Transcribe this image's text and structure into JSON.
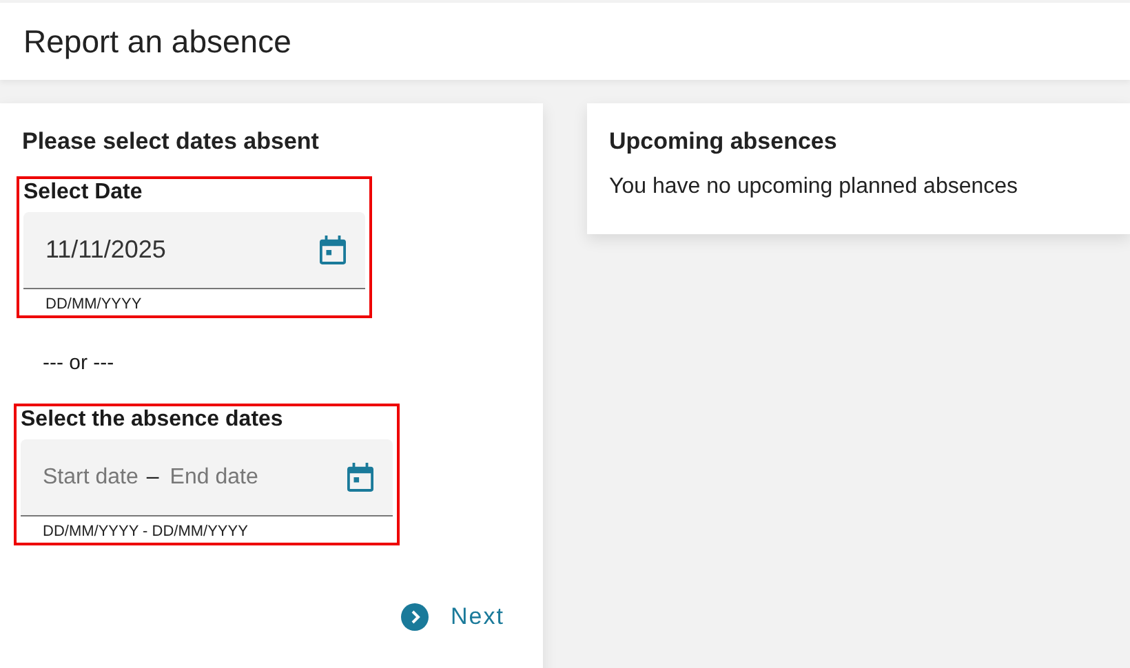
{
  "header": {
    "title": "Report an absence"
  },
  "form": {
    "title": "Please select dates absent",
    "single_date": {
      "label": "Select Date",
      "value": "11/11/2025",
      "hint": "DD/MM/YYYY"
    },
    "separator": "--- or ---",
    "date_range": {
      "label": "Select the absence dates",
      "start_placeholder": "Start date",
      "dash": "–",
      "end_placeholder": "End date",
      "hint": "DD/MM/YYYY - DD/MM/YYYY"
    },
    "next_button": "Next"
  },
  "upcoming": {
    "title": "Upcoming absences",
    "message": "You have no upcoming planned absences"
  }
}
